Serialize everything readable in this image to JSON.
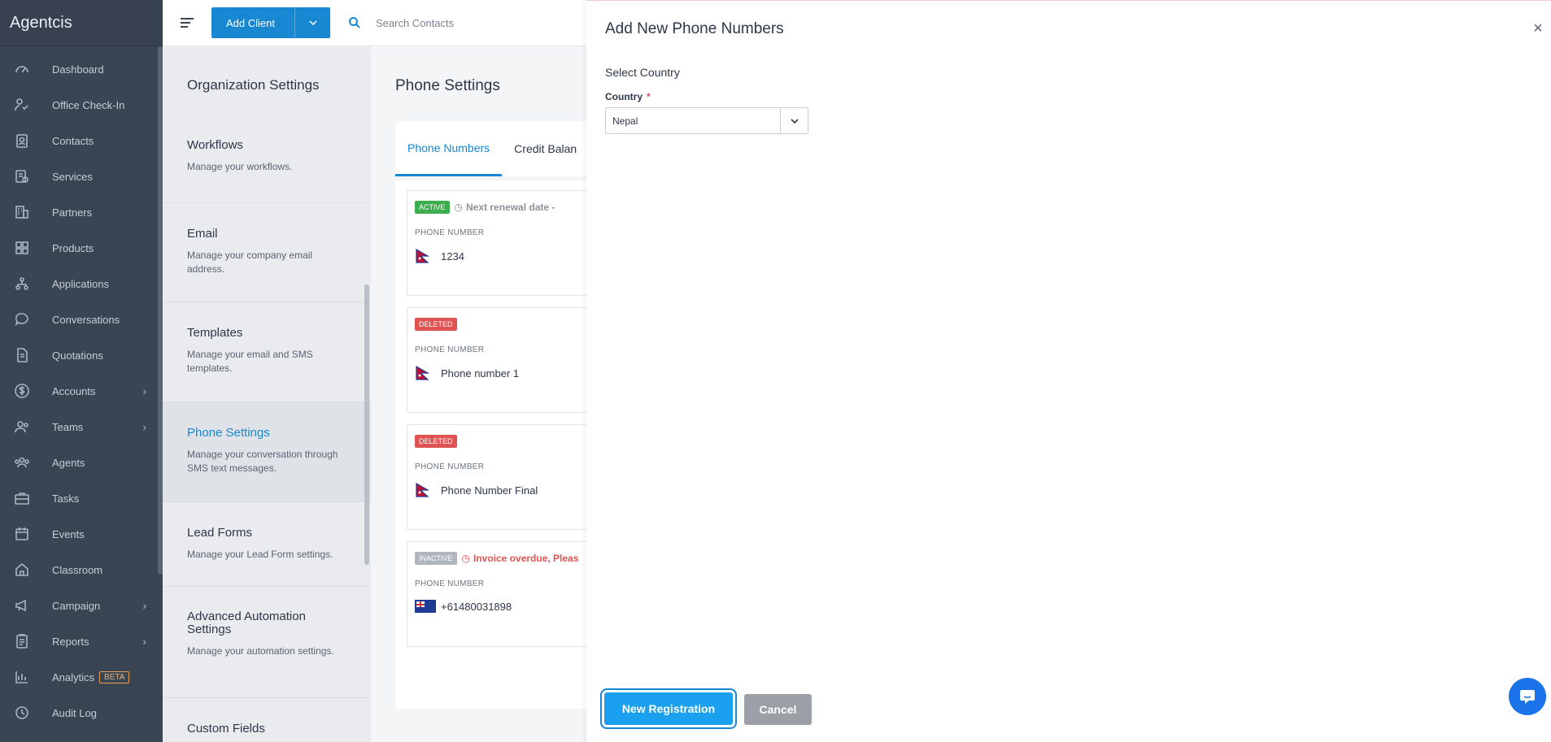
{
  "app": {
    "brand": "Agentcis"
  },
  "sidebar": {
    "items": [
      {
        "label": "Dashboard",
        "icon": "gauge-icon"
      },
      {
        "label": "Office Check-In",
        "icon": "check-in-icon"
      },
      {
        "label": "Contacts",
        "icon": "contacts-icon"
      },
      {
        "label": "Services",
        "icon": "services-icon"
      },
      {
        "label": "Partners",
        "icon": "building-icon"
      },
      {
        "label": "Products",
        "icon": "products-icon"
      },
      {
        "label": "Applications",
        "icon": "workflow-icon"
      },
      {
        "label": "Conversations",
        "icon": "chat-bubble-icon"
      },
      {
        "label": "Quotations",
        "icon": "document-icon"
      },
      {
        "label": "Accounts",
        "icon": "dollar-icon",
        "chevron": true
      },
      {
        "label": "Teams",
        "icon": "team-icon",
        "chevron": true
      },
      {
        "label": "Agents",
        "icon": "agents-icon"
      },
      {
        "label": "Tasks",
        "icon": "briefcase-icon"
      },
      {
        "label": "Events",
        "icon": "calendar-icon"
      },
      {
        "label": "Classroom",
        "icon": "classroom-icon"
      },
      {
        "label": "Campaign",
        "icon": "megaphone-icon",
        "chevron": true
      },
      {
        "label": "Reports",
        "icon": "clipboard-icon",
        "chevron": true
      },
      {
        "label": "Analytics",
        "icon": "bar-chart-icon",
        "badge": "BETA"
      },
      {
        "label": "Audit Log",
        "icon": "history-icon"
      }
    ]
  },
  "topbar": {
    "add_client": "Add Client",
    "search_placeholder": "Search Contacts"
  },
  "settings": {
    "title": "Organization Settings",
    "items": [
      {
        "title": "Workflows",
        "desc": "Manage your workflows."
      },
      {
        "title": "Email",
        "desc": "Manage your company email address."
      },
      {
        "title": "Templates",
        "desc": "Manage your email and SMS templates."
      },
      {
        "title": "Phone Settings",
        "desc": "Manage your conversation through SMS text messages."
      },
      {
        "title": "Lead Forms",
        "desc": "Manage your Lead Form settings."
      },
      {
        "title": "Advanced Automation Settings",
        "desc": "Manage your automation settings."
      },
      {
        "title": "Custom Fields",
        "desc": ""
      }
    ]
  },
  "phone": {
    "title": "Phone Settings",
    "tabs": [
      "Phone Numbers",
      "Credit Balan"
    ],
    "number_label": "PHONE NUMBER",
    "cards": [
      {
        "status": "ACTIVE",
        "note": "Next renewal date -",
        "number": "1234"
      },
      {
        "status": "DELETED",
        "note": "",
        "number": "Phone number 1"
      },
      {
        "status": "DELETED",
        "note": "",
        "number": "Phone Number Final"
      },
      {
        "status": "INACTIVE",
        "note": "Invoice overdue, Pleas",
        "number": "+61480031898"
      }
    ]
  },
  "panel": {
    "title": "Add New Phone Numbers",
    "close": "×",
    "section": "Select Country",
    "country_label": "Country",
    "required_mark": "*",
    "country_value": "Nepal",
    "primary_button": "New Registration",
    "cancel_button": "Cancel"
  },
  "colors": {
    "sidebar_bg": "#3a4553",
    "primary": "#1788d1",
    "active_badge": "#3dae4d",
    "deleted_badge": "#e05353"
  }
}
